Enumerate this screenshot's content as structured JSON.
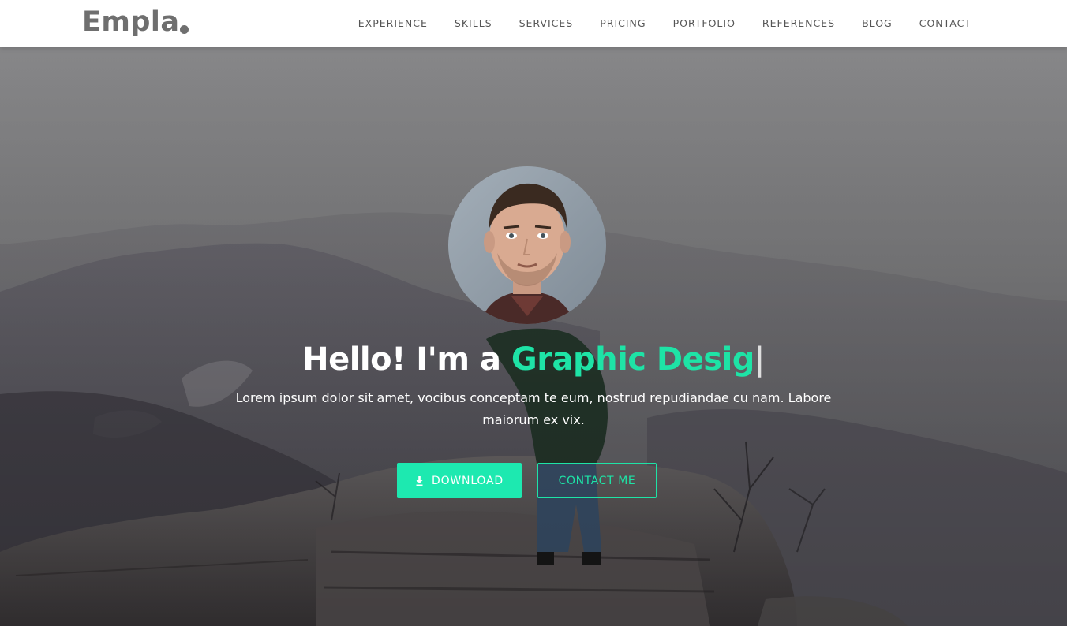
{
  "brand": {
    "name": "Empla"
  },
  "nav": {
    "items": [
      "EXPERIENCE",
      "SKILLS",
      "SERVICES",
      "PRICING",
      "PORTFOLIO",
      "REFERENCES",
      "BLOG",
      "CONTACT"
    ]
  },
  "hero": {
    "greeting": "Hello! I'm a ",
    "typed_text": "Graphic Desig",
    "cursor": "|",
    "description": "Lorem ipsum dolor sit amet, vocibus conceptam te eum, nostrud repudiandae cu nam. Labore maiorum ex vix.",
    "download_label": "DOWNLOAD",
    "download_icon": "download-icon",
    "contact_label": "CONTACT ME"
  },
  "colors": {
    "accent": "#1ee3a6",
    "button_fill": "#1de9b0",
    "header_bg": "#ffffff",
    "logo": "#6f6f6f"
  }
}
